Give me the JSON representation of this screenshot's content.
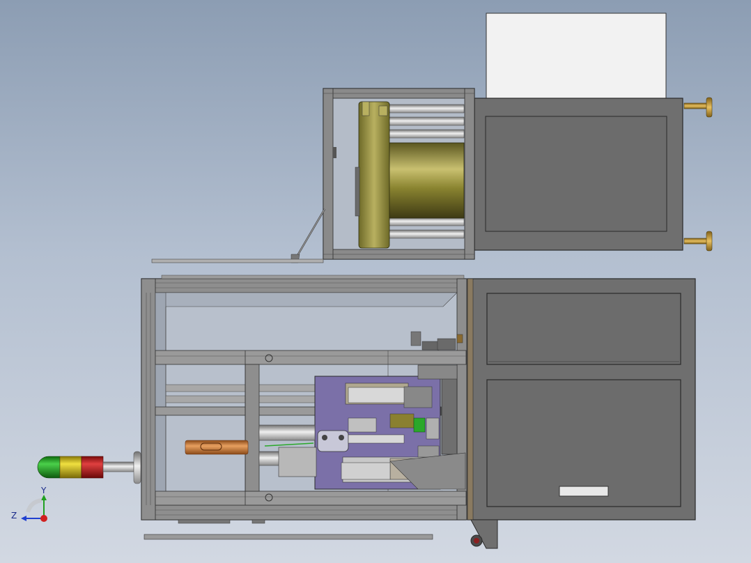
{
  "viewport": {
    "title": ""
  },
  "triad": {
    "y_label": "Y",
    "z_label": "Z"
  },
  "colors": {
    "background_top": "#8c9db3",
    "background_bottom": "#d2d8e2",
    "panel_gray": "#6f6f6f",
    "frame_gray": "#8a8a8a",
    "fixture_purple": "#7b70a8",
    "drum_olive": "#8a8430",
    "brass": "#c8a040",
    "copper_rod": "#c87838",
    "light_green": "#2aa82a",
    "light_yellow": "#d8c020",
    "light_red": "#c82020",
    "axis_x": "#d02020",
    "axis_y": "#20a020",
    "axis_z": "#2040d0"
  },
  "icons": [
    "signal-tower-icon",
    "coordinate-triad-icon",
    "leveling-foot-icon"
  ]
}
